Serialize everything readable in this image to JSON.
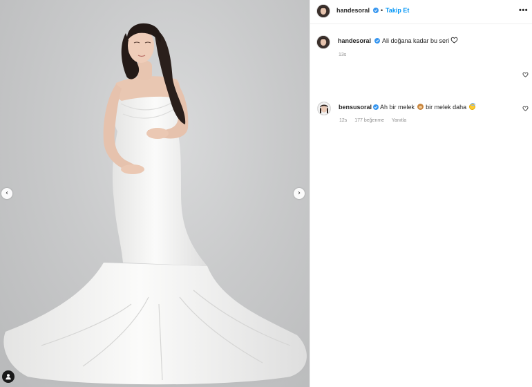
{
  "post": {
    "author": "handesoral",
    "separator": "•",
    "follow_label": "Takip Et",
    "more_label": "•••",
    "verified": true
  },
  "caption": {
    "username": "handesoral",
    "text": "Ali doğana kadar bu seri",
    "time": "13s"
  },
  "comments": [
    {
      "username": "bensusoral",
      "text_part1": "Ah bir melek",
      "text_part2": "bir melek daha",
      "emoji1": "monkey-emoji",
      "emoji2": "angel-emoji",
      "time": "12s",
      "likes": "177 beğenme",
      "reply_label": "Yanıtla"
    }
  ],
  "carousel": {
    "prev_icon": "chevron-left-icon",
    "next_icon": "chevron-right-icon",
    "prev_glyph": "‹",
    "next_glyph": "›",
    "tag_icon": "user-tag-icon"
  },
  "colors": {
    "follow": "#0095f6",
    "verified": "#3897f0",
    "meta": "#8e8e8e",
    "backdrop": "#c9cacb",
    "dress": "#f7f7f6"
  }
}
